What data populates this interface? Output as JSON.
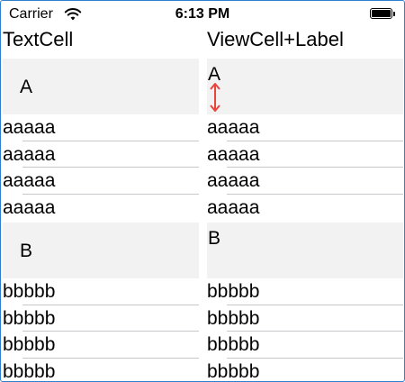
{
  "status_bar": {
    "carrier": "Carrier",
    "time": "6:13 PM",
    "wifi_icon": "wifi-icon",
    "battery_icon": "battery-icon"
  },
  "columns": {
    "left": {
      "title": "TextCell",
      "section_a": {
        "header": "A",
        "rows": [
          "aaaaa",
          "aaaaa",
          "aaaaa",
          "aaaaa"
        ]
      },
      "section_b": {
        "header": "B",
        "rows": [
          "bbbbb",
          "bbbbb",
          "bbbbb",
          "bbbbb"
        ]
      }
    },
    "right": {
      "title": "ViewCell+Label",
      "section_a": {
        "header": "A",
        "rows": [
          "aaaaa",
          "aaaaa",
          "aaaaa",
          "aaaaa"
        ]
      },
      "section_b": {
        "header": "B",
        "rows": [
          "bbbbb",
          "bbbbb",
          "bbbbb",
          "bbbbb"
        ]
      },
      "annotation_icon": "vertical-resize-arrow-icon",
      "annotation_color": "#e8453c"
    }
  },
  "colors": {
    "section_header_bg": "#f2f2f2",
    "separator": "#c8c7cc",
    "frame_border": "#2f7fd0"
  }
}
